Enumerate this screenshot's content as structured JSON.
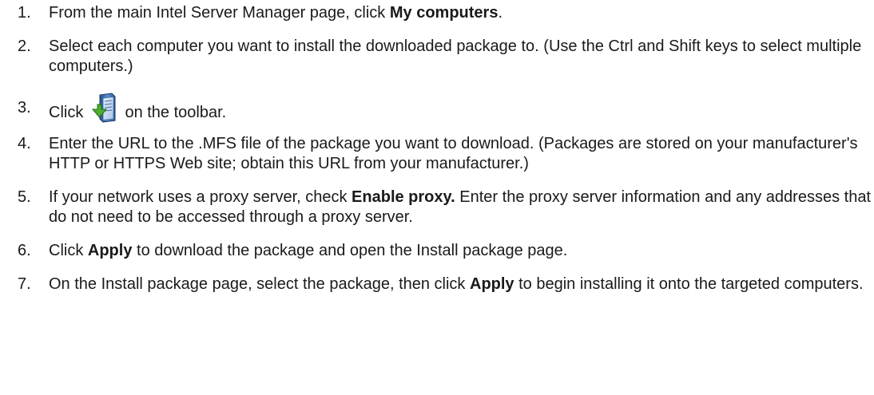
{
  "steps": [
    {
      "number": "1.",
      "text_before": "From the main Intel Server Manager page, click ",
      "bold": "My computers",
      "text_after": "."
    },
    {
      "number": "2.",
      "text": "Select each computer you want to install the downloaded package to. (Use the Ctrl and Shift keys to select multiple computers.)"
    },
    {
      "number": "3.",
      "text_before": "Click ",
      "icon": "install-package-icon",
      "text_after": " on the toolbar."
    },
    {
      "number": "4.",
      "text": "Enter the URL to the .MFS file of the package you want to download. (Packages are stored on your manufacturer's HTTP or HTTPS Web site; obtain this URL from your manufacturer.)"
    },
    {
      "number": "5.",
      "text_before": "If your network uses a proxy server, check ",
      "bold": "Enable proxy.",
      "text_after": " Enter the proxy server information and any addresses that do not need to be accessed through a proxy server."
    },
    {
      "number": "6.",
      "text_before": "Click ",
      "bold": "Apply",
      "text_after": " to download the package and open the Install package page."
    },
    {
      "number": "7.",
      "text_before": "On the Install package page, select the package, then click ",
      "bold": "Apply",
      "text_after": " to begin installing it onto the targeted computers."
    }
  ]
}
